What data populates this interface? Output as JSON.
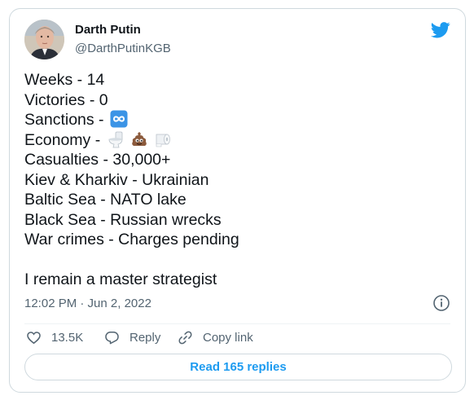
{
  "author": {
    "name": "Darth Putin",
    "handle": "@DarthPutinKGB"
  },
  "tweet": {
    "lines": [
      "Weeks - 14",
      "Victories - 0",
      "Sanctions -",
      "Economy -",
      "Casualties - 30,000+",
      "Kiev & Kharkiv - Ukrainian",
      "Baltic Sea - NATO lake",
      "Black Sea - Russian wrecks",
      "War crimes - Charges pending"
    ],
    "closing": "I remain a master strategist",
    "emojis": {
      "sanctions": [
        "infinity-icon"
      ],
      "economy": [
        "toilet-icon",
        "poop-icon",
        "toilet-paper-icon"
      ]
    }
  },
  "timestamp": "12:02 PM · Jun 2, 2022",
  "actions": {
    "likes": "13.5K",
    "reply_label": "Reply",
    "copy_label": "Copy link"
  },
  "read_replies_label": "Read 165 replies",
  "colors": {
    "accent": "#1d9bf0",
    "text": "#0f1419",
    "muted": "#536471",
    "border": "#cfd9de"
  }
}
